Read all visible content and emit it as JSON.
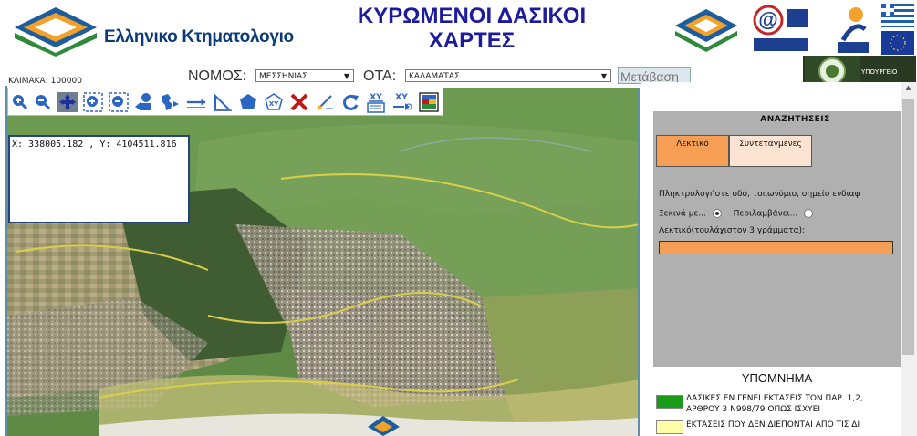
{
  "header": {
    "logo_text": "Ελληνικο Κτηματολογιο",
    "title_line1": "ΚΥΡΩΜΕΝΟΙ ΔΑΣΙΚΟΙ",
    "title_line2": "ΧΑΡΤΕΣ",
    "ministry_logo_text": "ΥΠΟΥΡΓΕΙΟ"
  },
  "controls": {
    "scale_label": "ΚΛΙΜΑΚΑ: 100000",
    "nomos_label": "ΝΟΜΟΣ:",
    "nomos_value": "ΜΕΣΣΗΝΙΑΣ",
    "ota_label": "ΟΤΑ:",
    "ota_value": "ΚΑΛΑΜΑΤΑΣ",
    "go_button": "Μετάβαση"
  },
  "toolbar": {
    "tools": [
      "zoom-in-icon",
      "zoom-out-icon",
      "pan-icon",
      "zoom-box-in-icon",
      "zoom-box-out-icon",
      "previous-view-icon",
      "full-extent-icon",
      "measure-distance-icon",
      "measure-angle-icon",
      "measure-area-icon",
      "xy-polygon-icon",
      "clear-icon",
      "edit-point-icon",
      "refresh-icon",
      "xy-identify-icon",
      "xy-goto-icon",
      "print-map-icon"
    ]
  },
  "map": {
    "coordinates": "X: 338005.182 , Y: 4104511.816"
  },
  "search": {
    "title": "ΑΝΑΖΗΤΗΣΕΙΣ",
    "tab_text": "Λεκτικό",
    "tab_coords": "Συντεταγμένες",
    "hint": "Πληκτρολογήστε οδό, τοπωνύμιο, σημείο ενδιαφ",
    "radio_starts": "Ξεκινά με...",
    "radio_contains": "Περιλαμβάνει...",
    "word_label": "Λεκτικό(τουλάχιστον 3 γράμματα):",
    "word_value": ""
  },
  "legend": {
    "title": "ΥΠΟΜΝΗΜΑ",
    "items": [
      {
        "line1": "ΔΑΣΙΚΕΣ ΕΝ ΓΕΝΕΙ ΕΚΤΑΣΕΙΣ ΤΩΝ ΠΑΡ. 1,2,",
        "line2": "ΑΡΘΡΟΥ 3 Ν998/79 ΟΠΩΣ ΙΣΧΥΕΙ",
        "color": "#1a9c1a"
      },
      {
        "line1": "ΕΚΤΑΣΕΙΣ ΠΟΥ ΔΕΝ ΔΙΕΠΟΝΤΑΙ ΑΠΟ ΤΙΣ ΔΙ",
        "line2": "",
        "color": "#ffffa8"
      }
    ]
  },
  "colors": {
    "title_blue": "#1c1c9c",
    "search_orange": "#f79e55",
    "panel_gray": "#b0b0b0",
    "forest_green": "#1a9c1a"
  }
}
